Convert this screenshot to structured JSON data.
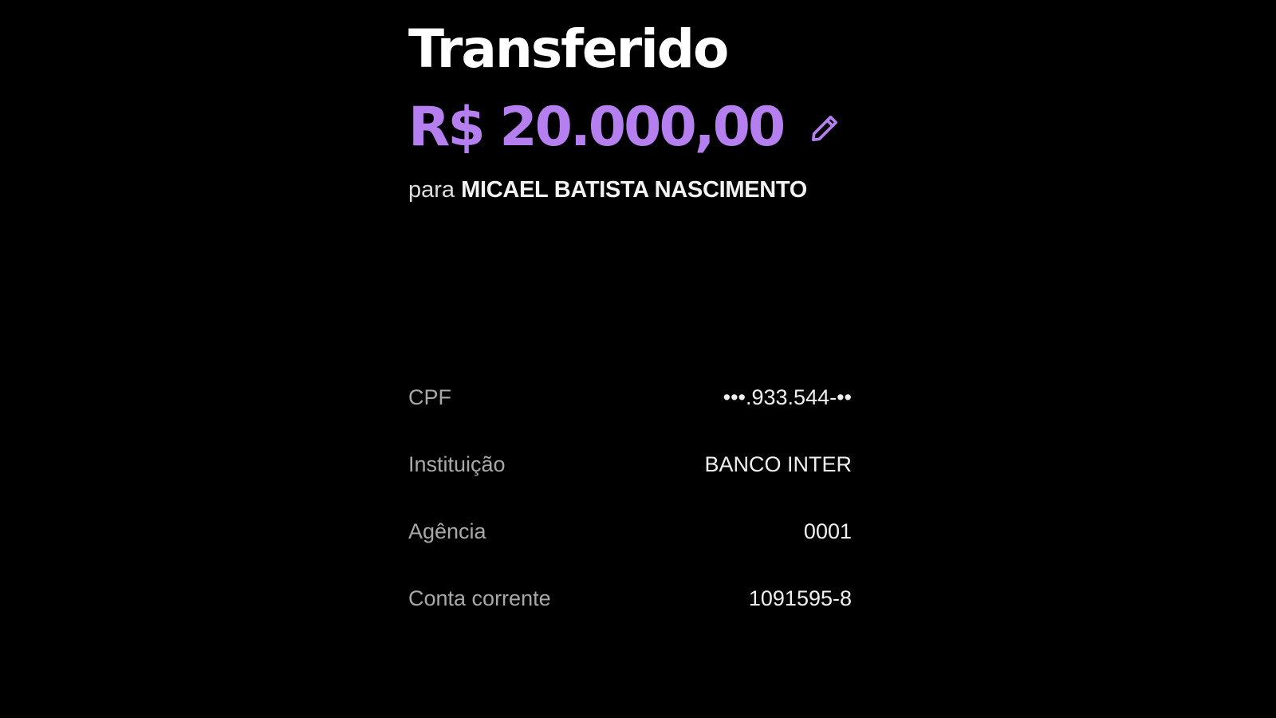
{
  "header": {
    "title": "Transferido"
  },
  "transfer": {
    "amount": "R$ 20.000,00",
    "recipient_prefix": "para",
    "recipient_name": "MICAEL BATISTA NASCIMENTO",
    "edit_icon": "pencil-icon"
  },
  "details": {
    "rows": [
      {
        "label": "CPF",
        "value": "•••.933.544-••"
      },
      {
        "label": "Instituição",
        "value": "BANCO INTER"
      },
      {
        "label": "Agência",
        "value": "0001"
      },
      {
        "label": "Conta corrente",
        "value": "1091595-8"
      }
    ]
  },
  "colors": {
    "background": "#000000",
    "accent": "#b57ff0",
    "title": "#ffffff",
    "label": "#a8a8a8",
    "value": "#f0f0f0"
  }
}
